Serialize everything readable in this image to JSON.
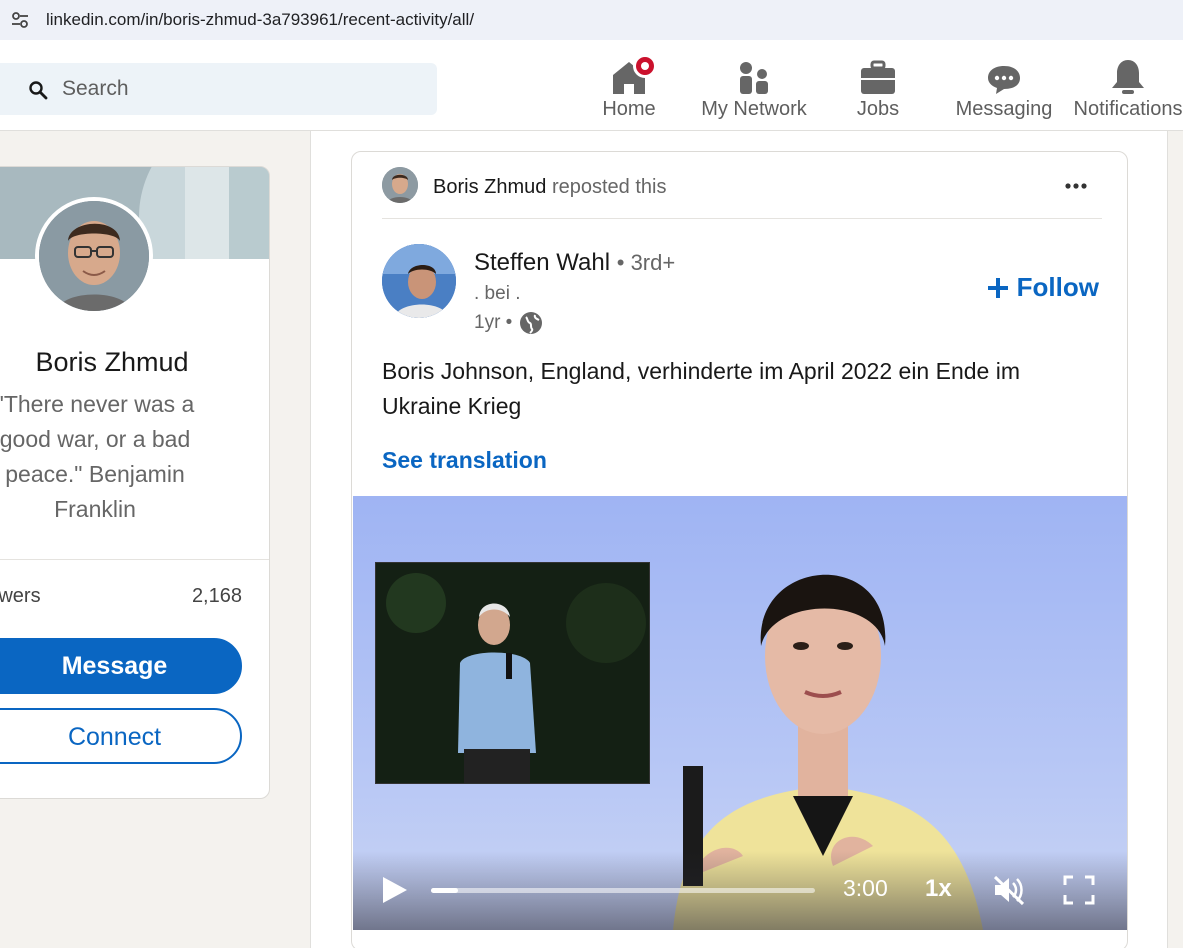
{
  "browser": {
    "url": "linkedin.com/in/boris-zhmud-3a793961/recent-activity/all/"
  },
  "nav": {
    "search_placeholder": "Search",
    "items": [
      {
        "label": "Home"
      },
      {
        "label": "My Network"
      },
      {
        "label": "Jobs"
      },
      {
        "label": "Messaging"
      },
      {
        "label": "Notifications"
      }
    ]
  },
  "profile": {
    "name": "Boris Zhmud",
    "tagline": "\"There never was a good war, or a bad peace.\" Benjamin Franklin",
    "followers_label": "Followers",
    "followers_count": "2,168",
    "message_label": "Message",
    "connect_label": "Connect"
  },
  "post": {
    "reposter": "Boris Zhmud",
    "repost_suffix": "reposted this",
    "author": "Steffen Wahl",
    "degree": "• 3rd+",
    "subtitle": ". bei .",
    "time": "1yr •",
    "follow_label": "Follow",
    "text": "Boris Johnson, England, verhinderte im April 2022 ein Ende im Ukraine Krieg",
    "see_translation": "See translation",
    "video": {
      "duration": "3:00",
      "speed": "1x",
      "progress": 0.07
    }
  },
  "colors": {
    "accent": "#0a66c2",
    "badge": "#cb112d"
  }
}
